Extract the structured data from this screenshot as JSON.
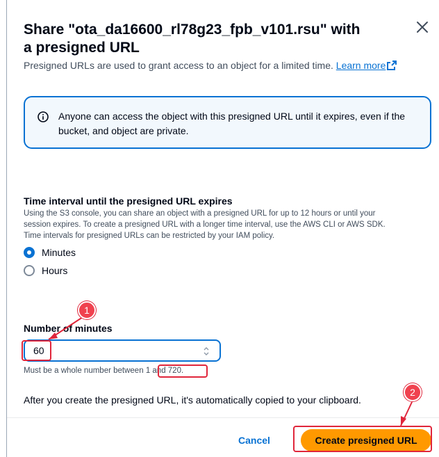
{
  "dialog": {
    "title": "Share \"ota_da16600_rl78g23_fpb_v101.rsu\" with a presigned URL",
    "description": "Presigned URLs are used to grant access to an object for a limited time.",
    "learn_more": "Learn more",
    "close_icon": "close-icon"
  },
  "alert": {
    "icon": "info-icon",
    "text": "Anyone can access the object with this presigned URL until it expires, even if the bucket, and object are private."
  },
  "time_interval": {
    "title": "Time interval until the presigned URL expires",
    "help_line1": "Using the S3 console, you can share an object with a presigned URL for up to 12 hours or until your",
    "help_line2": "session expires. To create a presigned URL with a longer time interval, use the AWS CLI or AWS SDK.",
    "help_line3": "Time intervals for presigned URLs can be restricted by your IAM policy.",
    "options": [
      {
        "label": "Minutes",
        "checked": true
      },
      {
        "label": "Hours",
        "checked": false
      }
    ]
  },
  "minutes": {
    "label": "Number of minutes",
    "value": "60",
    "help": "Must be a whole number between",
    "help_range": "1 and 720."
  },
  "info_text": "After you create the presigned URL, it's automatically copied to your clipboard.",
  "footer": {
    "cancel": "Cancel",
    "create": "Create presigned URL"
  },
  "annotations": [
    "1",
    "2"
  ],
  "colors": {
    "accent": "#0972d3",
    "primary_button": "#ff9900",
    "annotation": "#e0263b"
  }
}
